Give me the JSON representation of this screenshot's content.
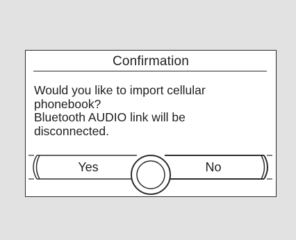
{
  "dialog": {
    "title": "Confirmation",
    "message_lines": [
      "Would you like to import cellular",
      "phonebook?",
      "Bluetooth AUDIO link will be",
      "disconnected."
    ]
  },
  "buttons": {
    "yes_label": "Yes",
    "no_label": "No",
    "selected": "No"
  },
  "colors": {
    "background": "#e2e2e2",
    "dialog_background": "#ffffff",
    "border": "#2a2a2a",
    "text": "#1e1e1e"
  },
  "icons": {
    "center_knob": "knob-icon"
  }
}
